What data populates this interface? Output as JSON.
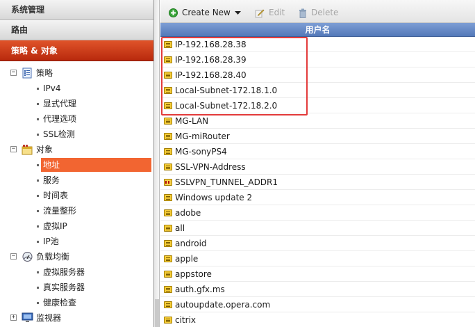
{
  "sidebar": {
    "sections": {
      "system": "系统管理",
      "router": "路由",
      "policy_objects": "策略 & 对象"
    },
    "tree": {
      "policy": {
        "label": "策略",
        "items": [
          "IPv4",
          "显式代理",
          "代理选项",
          "SSL检测"
        ]
      },
      "objects": {
        "label": "对象",
        "items": [
          "地址",
          "服务",
          "时间表",
          "流量整形",
          "虚拟IP",
          "IP池"
        ],
        "selected": "地址"
      },
      "load_balance": {
        "label": "负载均衡",
        "items": [
          "虚拟服务器",
          "真实服务器",
          "健康检查"
        ]
      },
      "monitor": {
        "label": "监视器"
      }
    }
  },
  "toolbar": {
    "create_new": "Create New",
    "edit": "Edit",
    "delete": "Delete"
  },
  "table": {
    "column_header": "用户名",
    "rows": [
      {
        "name": "IP-192.168.28.38",
        "icon": "address-icon"
      },
      {
        "name": "IP-192.168.28.39",
        "icon": "address-icon"
      },
      {
        "name": "IP-192.168.28.40",
        "icon": "address-icon"
      },
      {
        "name": "Local-Subnet-172.18.1.0",
        "icon": "address-icon"
      },
      {
        "name": "Local-Subnet-172.18.2.0",
        "icon": "address-icon"
      },
      {
        "name": "MG-LAN",
        "icon": "address-icon"
      },
      {
        "name": "MG-miRouter",
        "icon": "address-icon"
      },
      {
        "name": "MG-sonyPS4",
        "icon": "address-icon"
      },
      {
        "name": "SSL-VPN-Address",
        "icon": "address-icon"
      },
      {
        "name": "SSLVPN_TUNNEL_ADDR1",
        "icon": "ip-range-icon"
      },
      {
        "name": "Windows update 2",
        "icon": "fqdn-icon"
      },
      {
        "name": "adobe",
        "icon": "fqdn-icon"
      },
      {
        "name": "all",
        "icon": "fqdn-icon"
      },
      {
        "name": "android",
        "icon": "fqdn-icon"
      },
      {
        "name": "apple",
        "icon": "fqdn-icon"
      },
      {
        "name": "appstore",
        "icon": "fqdn-icon"
      },
      {
        "name": "auth.gfx.ms",
        "icon": "fqdn-icon"
      },
      {
        "name": "autoupdate.opera.com",
        "icon": "fqdn-icon"
      },
      {
        "name": "citrix",
        "icon": "fqdn-icon"
      }
    ]
  },
  "colors": {
    "active_section": "#c8361a",
    "selected_item": "#f26531",
    "table_header": "#6588c6",
    "highlight_box": "#e33b3b"
  }
}
